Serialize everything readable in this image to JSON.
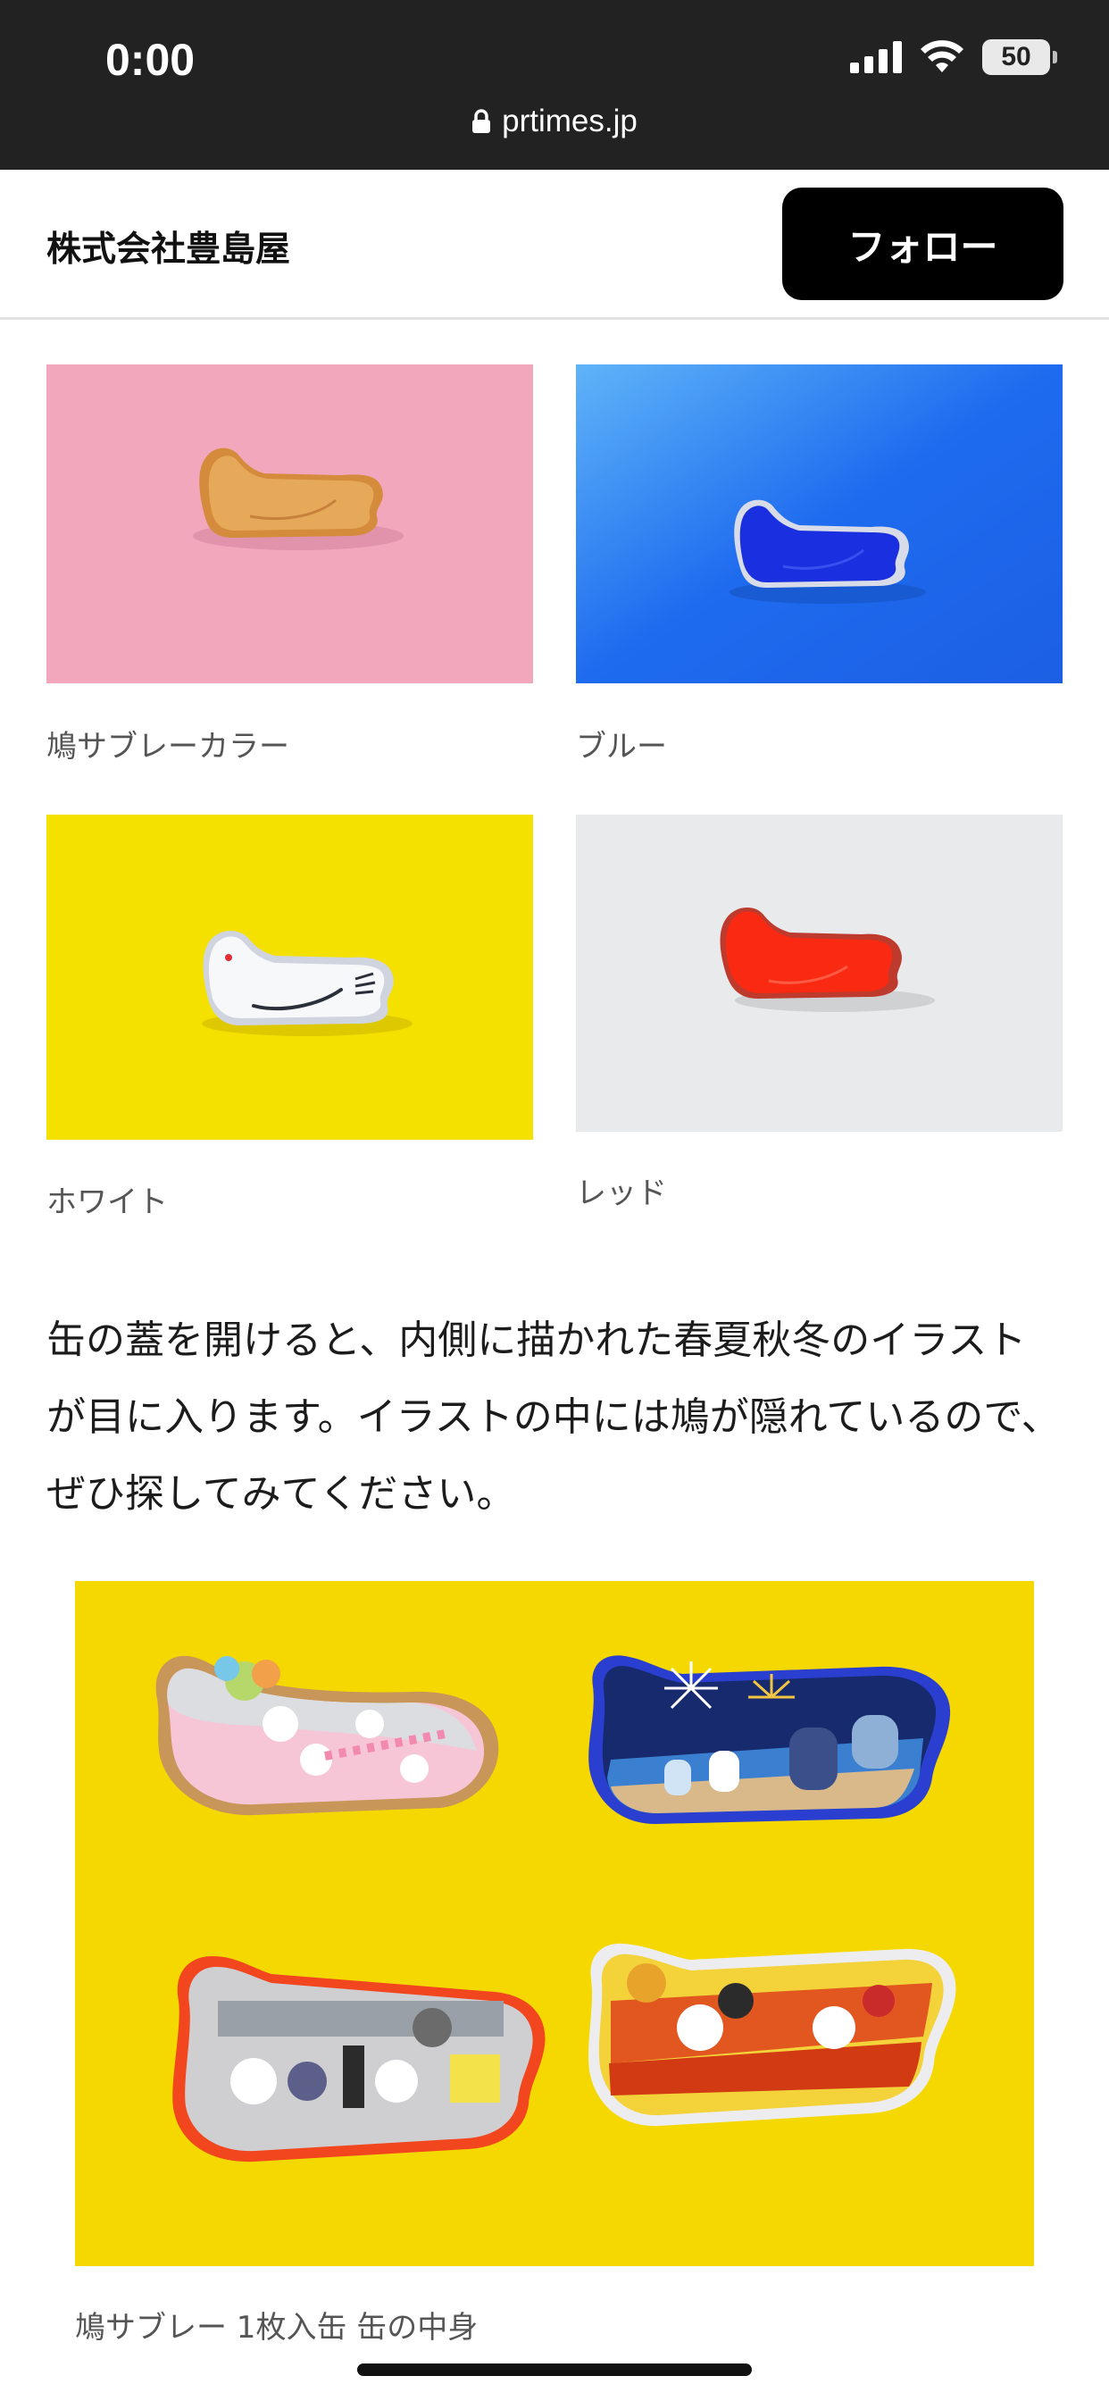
{
  "status_bar": {
    "time": "0:00",
    "battery": "50",
    "url": "prtimes.jp"
  },
  "header": {
    "company_name": "株式会社豊島屋",
    "follow_label": "フォロー"
  },
  "colors": {
    "pink": "#F2A7BD",
    "blue": "#1E6BEF",
    "yellow": "#F5E100",
    "white_bg": "#E9EAEC",
    "red": "#FA2A12",
    "royal_blue": "#1A2FE0",
    "orange_tin": "#D9903F"
  },
  "photos": [
    {
      "caption": "鳩サブレーカラー",
      "icon": "orange-dove-tin"
    },
    {
      "caption": "ブルー",
      "icon": "blue-dove-tin"
    },
    {
      "caption": "ホワイト",
      "icon": "white-dove-tin"
    },
    {
      "caption": "レッド",
      "icon": "red-dove-tin"
    }
  ],
  "article": {
    "paragraph": "缶の蓋を開けると、内側に描かれた春夏秋冬のイラストが目に入ります。イラストの中には鳩が隠れているので、ぜひ探してみてください。",
    "big_photo_caption": "鳩サブレー 1枚入缶 缶の中身"
  }
}
